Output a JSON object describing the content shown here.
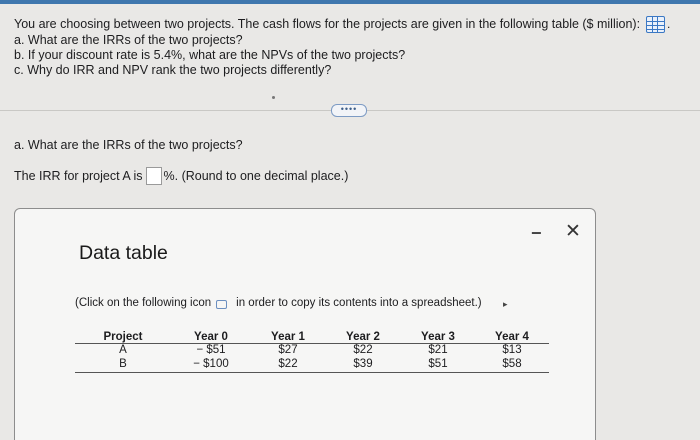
{
  "question": {
    "intro": "You are choosing between two projects. The cash flows for the projects are given in the following table ($ million):",
    "items": [
      "a. What are the IRRs of the two projects?",
      "b. If your discount rate is 5.4%, what are the NPVs of the two projects?",
      "c. Why do IRR and NPV rank the two projects differently?"
    ]
  },
  "more_button": "••••",
  "part_a": {
    "heading": "a. What are the IRRs of the two projects?",
    "irr_prefix": "The IRR for project A is",
    "irr_value": "",
    "irr_suffix": "%. (Round to one decimal place.)"
  },
  "modal": {
    "title": "Data table",
    "minimize_icon": "minimize-icon",
    "close_icon": "close-icon",
    "instructions_before": "(Click on the following icon",
    "instructions_after": "in order to copy its contents into a spreadsheet.)",
    "table": {
      "headers": [
        "Project",
        "Year 0",
        "Year 1",
        "Year 2",
        "Year 3",
        "Year 4"
      ],
      "rows": [
        [
          "A",
          "− $51",
          "$27",
          "$22",
          "$21",
          "$13"
        ],
        [
          "B",
          "− $100",
          "$22",
          "$39",
          "$51",
          "$58"
        ]
      ]
    }
  },
  "colors": {
    "accent": "#3f77ae",
    "background": "#e9e8e6",
    "modal_bg": "#f6f6f5"
  }
}
